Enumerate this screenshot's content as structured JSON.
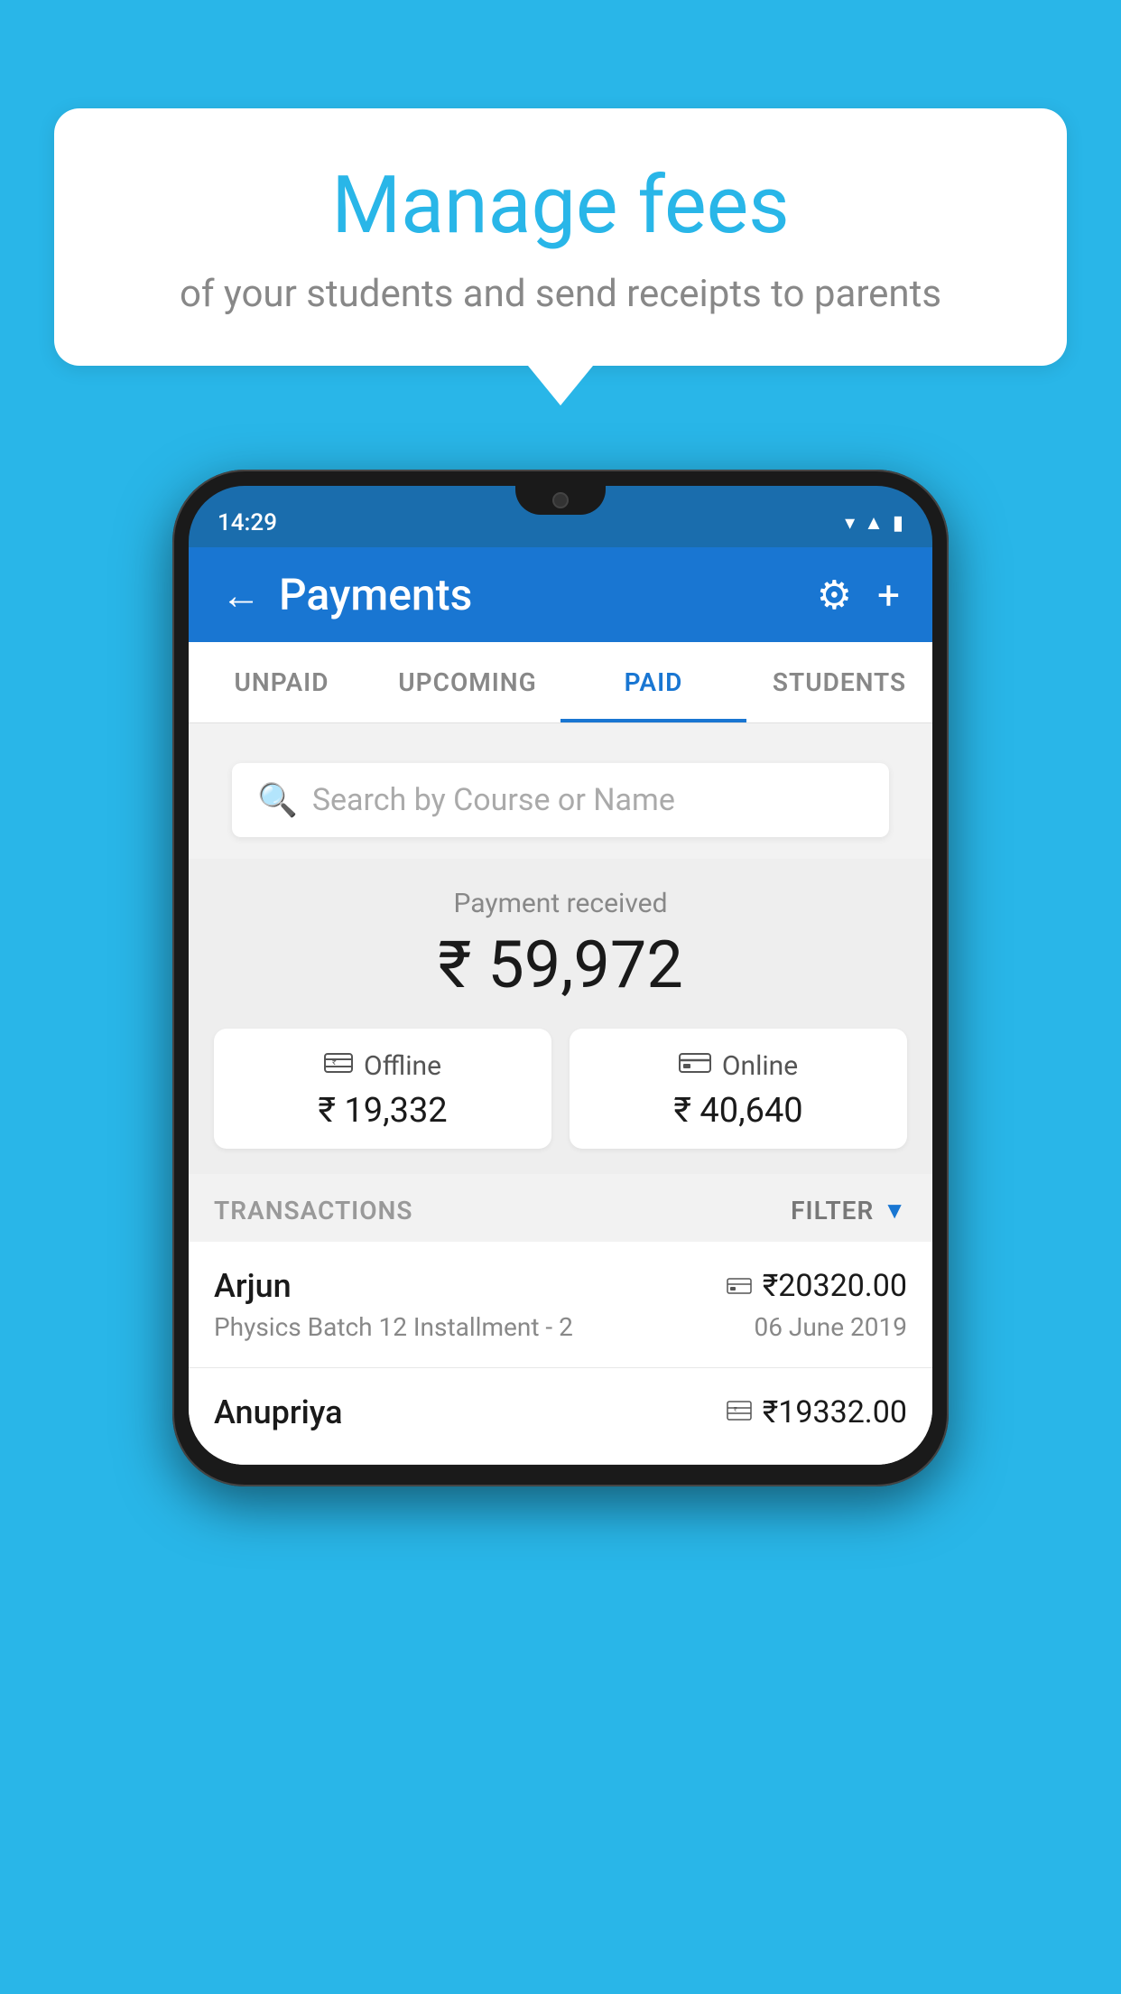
{
  "background_color": "#29b6e8",
  "speech_bubble": {
    "title": "Manage fees",
    "subtitle": "of your students and send receipts to parents"
  },
  "status_bar": {
    "time": "14:29",
    "wifi_icon": "▼",
    "signal_icon": "▲",
    "battery_icon": "▮"
  },
  "app_header": {
    "back_label": "←",
    "title": "Payments",
    "settings_icon": "⚙",
    "add_icon": "+"
  },
  "tabs": [
    {
      "label": "UNPAID",
      "active": false
    },
    {
      "label": "UPCOMING",
      "active": false
    },
    {
      "label": "PAID",
      "active": true
    },
    {
      "label": "STUDENTS",
      "active": false
    }
  ],
  "search": {
    "placeholder": "Search by Course or Name"
  },
  "payment_received": {
    "label": "Payment received",
    "total": "₹ 59,972",
    "offline": {
      "icon": "₹",
      "type": "Offline",
      "amount": "₹ 19,332"
    },
    "online": {
      "icon": "▬",
      "type": "Online",
      "amount": "₹ 40,640"
    }
  },
  "transactions": {
    "label": "TRANSACTIONS",
    "filter_label": "FILTER",
    "items": [
      {
        "name": "Arjun",
        "detail": "Physics Batch 12 Installment - 2",
        "amount": "₹20320.00",
        "type_icon": "▬",
        "date": "06 June 2019"
      },
      {
        "name": "Anupriya",
        "detail": "",
        "amount": "₹19332.00",
        "type_icon": "₹",
        "date": ""
      }
    ]
  }
}
